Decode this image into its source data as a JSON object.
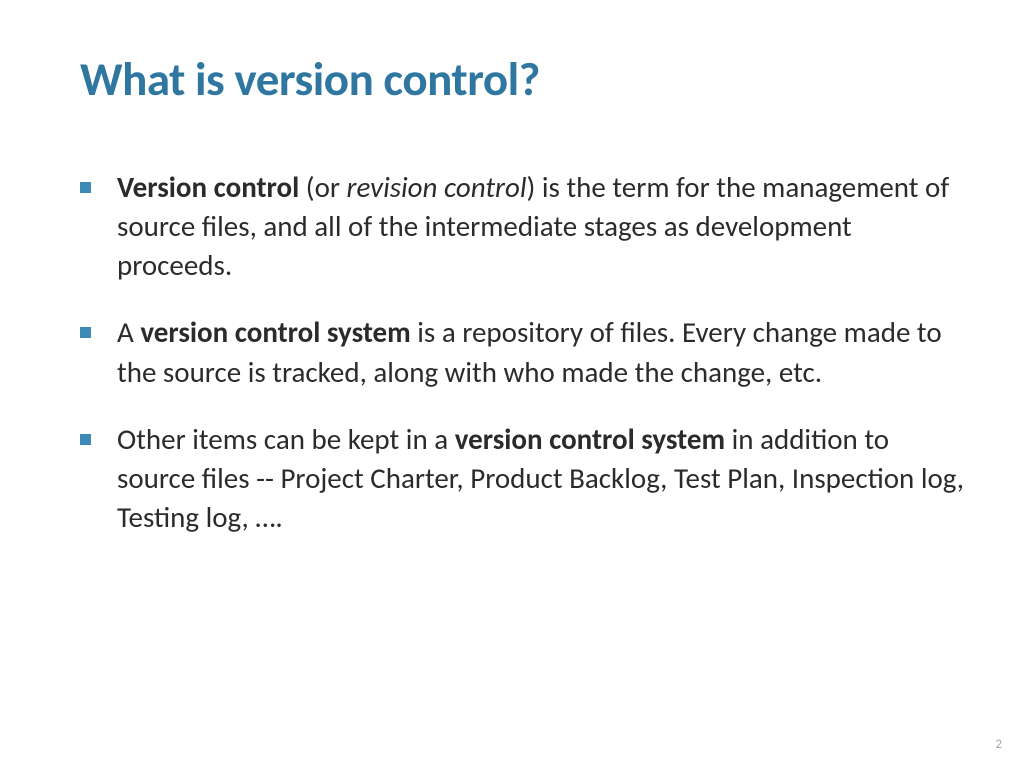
{
  "slide": {
    "title": "What is version control?",
    "bullets": [
      {
        "segments": [
          {
            "text": "Version control",
            "bold": true
          },
          {
            "text": " (or "
          },
          {
            "text": "revision control",
            "italic": true
          },
          {
            "text": ") is the term for the management of source files, and all of the intermediate stages as development proceeds."
          }
        ]
      },
      {
        "segments": [
          {
            "text": "A "
          },
          {
            "text": "version control system",
            "bold": true
          },
          {
            "text": " is a repository of files. Every change made to the source is tracked, along with who made the change, etc."
          }
        ]
      },
      {
        "segments": [
          {
            "text": "Other items can be kept in a "
          },
          {
            "text": "version control system",
            "bold": true
          },
          {
            "text": " in addition to source files -- Project Charter, Product Backlog, Test Plan, Inspection log, Testing log, …."
          }
        ]
      }
    ],
    "page_number": "2"
  }
}
